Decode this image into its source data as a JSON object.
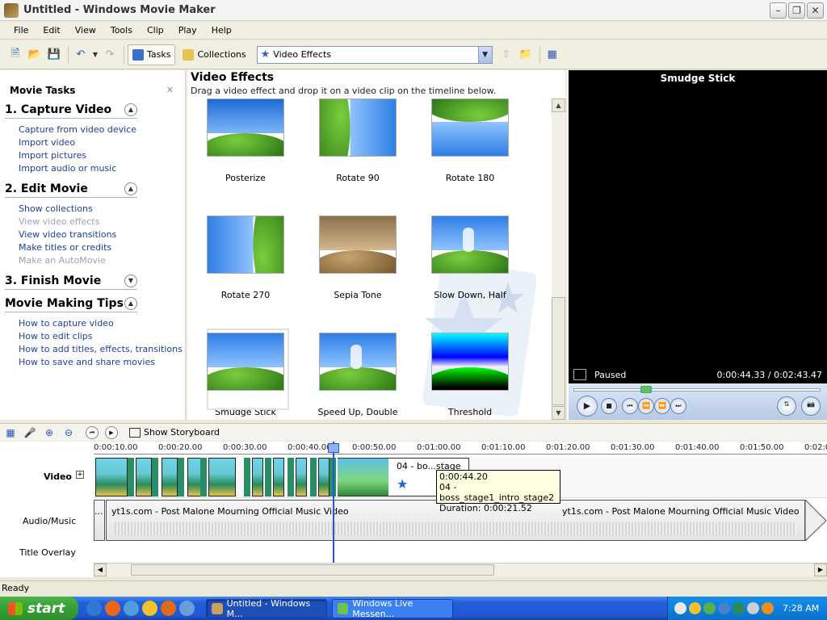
{
  "window": {
    "title": "Untitled - Windows Movie Maker"
  },
  "menu": [
    "File",
    "Edit",
    "View",
    "Tools",
    "Clip",
    "Play",
    "Help"
  ],
  "toolbar": {
    "tasks_label": "Tasks",
    "collections_label": "Collections",
    "collection_value": "Video Effects"
  },
  "taskpane": {
    "title": "Movie Tasks",
    "sections": [
      {
        "title": "1. Capture Video",
        "items": [
          {
            "label": "Capture from video device"
          },
          {
            "label": "Import video"
          },
          {
            "label": "Import pictures"
          },
          {
            "label": "Import audio or music"
          }
        ]
      },
      {
        "title": "2. Edit Movie",
        "items": [
          {
            "label": "Show collections"
          },
          {
            "label": "View video effects",
            "disabled": true
          },
          {
            "label": "View video transitions"
          },
          {
            "label": "Make titles or credits"
          },
          {
            "label": "Make an AutoMovie",
            "disabled": true
          }
        ]
      },
      {
        "title": "3. Finish Movie",
        "items": []
      },
      {
        "title": "Movie Making Tips",
        "items": [
          {
            "label": "How to capture video"
          },
          {
            "label": "How to edit clips"
          },
          {
            "label": "How to add titles, effects, transitions"
          },
          {
            "label": "How to save and share movies"
          }
        ]
      }
    ]
  },
  "content": {
    "title": "Video Effects",
    "subtitle": "Drag a video effect and drop it on a video clip on the timeline below.",
    "effects": [
      {
        "label": "Posterize",
        "style": "posterize"
      },
      {
        "label": "Rotate 90",
        "style": "rot90"
      },
      {
        "label": "Rotate 180",
        "style": "rot180"
      },
      {
        "label": "Rotate 270",
        "style": "rot270"
      },
      {
        "label": "Sepia Tone",
        "style": "sepia"
      },
      {
        "label": "Slow Down, Half",
        "style": "slow"
      },
      {
        "label": "Smudge Stick",
        "style": "normal",
        "selected": true
      },
      {
        "label": "Speed Up, Double",
        "style": "speed"
      },
      {
        "label": "Threshold",
        "style": "threshold"
      }
    ]
  },
  "monitor": {
    "title": "Smudge Stick",
    "status": "Paused",
    "time": "0:00:44.33 / 0:02:43.47",
    "progress_pct": 27
  },
  "timeline": {
    "show_storyboard": "Show Storyboard",
    "ruler": [
      "0:00:10.00",
      "0:00:20.00",
      "0:00:30.00",
      "0:00:40.00",
      "0:00:50.00",
      "0:01:00.00",
      "0:01:10.00",
      "0:01:20.00",
      "0:01:30.00",
      "0:01:40.00",
      "0:01:50.00",
      "0:02:0"
    ],
    "tracks": {
      "video": "Video",
      "audio": "Audio/Music",
      "title": "Title Overlay"
    },
    "clip2_title": "04 - bo...stage",
    "tooltip": {
      "time": "0:00:44.20",
      "name": "04 - boss_stage1_intro_stage2",
      "duration": "Duration:  0:00:21.52"
    },
    "audio_clips": [
      "yt1s.com - Post Malone  Mourning Official Music Video",
      "yt1s.com - Post Malone  Mourning Official Music Video"
    ],
    "audio_start_label": "..."
  },
  "status": "Ready",
  "taskbar": {
    "start": "start",
    "tasks": [
      "Untitled - Windows M...",
      "Windows Live Messen..."
    ],
    "clock": "7:28 AM"
  }
}
